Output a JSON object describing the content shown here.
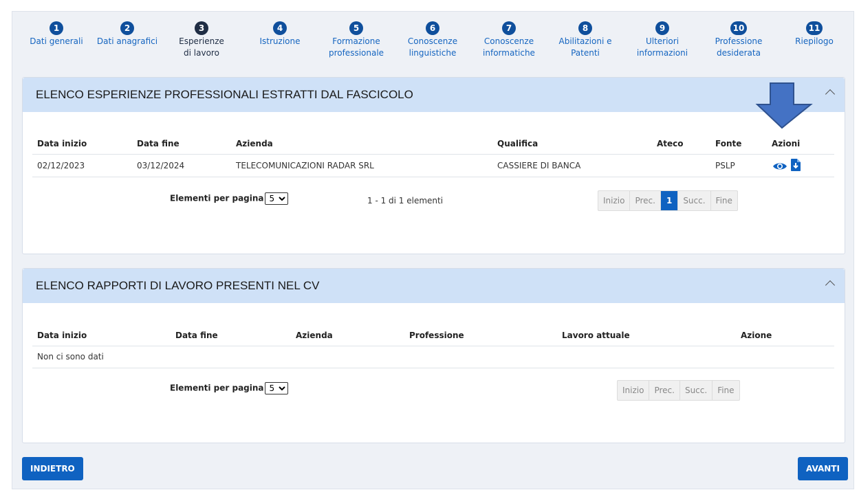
{
  "stepper": [
    {
      "num": "1",
      "label": "Dati generali",
      "state": "link"
    },
    {
      "num": "2",
      "label": "Dati anagrafici",
      "state": "link"
    },
    {
      "num": "3",
      "label": "Esperienze di lavoro",
      "state": "current"
    },
    {
      "num": "4",
      "label": "Istruzione",
      "state": "link"
    },
    {
      "num": "5",
      "label": "Formazione professionale",
      "state": "link"
    },
    {
      "num": "6",
      "label": "Conoscenze linguistiche",
      "state": "link"
    },
    {
      "num": "7",
      "label": "Conoscenze informatiche",
      "state": "link"
    },
    {
      "num": "8",
      "label": "Abilitazioni e Patenti",
      "state": "link"
    },
    {
      "num": "9",
      "label": "Ulteriori informazioni",
      "state": "link"
    },
    {
      "num": "10",
      "label": "Professione desiderata",
      "state": "link"
    },
    {
      "num": "11",
      "label": "Riepilogo",
      "state": "link"
    }
  ],
  "panel1": {
    "title": "ELENCO ESPERIENZE PROFESSIONALI ESTRATTI DAL FASCICOLO",
    "columns": [
      "Data inizio",
      "Data fine",
      "Azienda",
      "Qualifica",
      "Ateco",
      "Fonte",
      "Azioni"
    ],
    "rows": [
      [
        "02/12/2023",
        "03/12/2024",
        "TELECOMUNICAZIONI RADAR SRL",
        "CASSIERE DI BANCA",
        "",
        "PSLP"
      ]
    ],
    "page_size_label": "Elementi per pagina",
    "page_size": "5",
    "count_text": "1 - 1 di 1 elementi",
    "pager": [
      "Inizio",
      "Prec.",
      "1",
      "Succ.",
      "Fine"
    ],
    "current_page": "1"
  },
  "panel2": {
    "title": "ELENCO RAPPORTI DI LAVORO PRESENTI NEL CV",
    "columns": [
      "Data inizio",
      "Data fine",
      "Azienda",
      "Professione",
      "Lavoro attuale",
      "Azione"
    ],
    "empty_text": "Non ci sono dati",
    "page_size_label": "Elementi per pagina",
    "page_size": "5",
    "pager": [
      "Inizio",
      "Prec.",
      "Succ.",
      "Fine"
    ]
  },
  "buttons": {
    "back": "INDIETRO",
    "next": "AVANTI"
  },
  "colors": {
    "primary": "#0f62c1",
    "header_bg": "#cfe1f7",
    "arrow": "#4472c4"
  },
  "icons": {
    "view": "eye-icon",
    "download": "file-download-icon",
    "annotation": "arrow-down-icon"
  }
}
